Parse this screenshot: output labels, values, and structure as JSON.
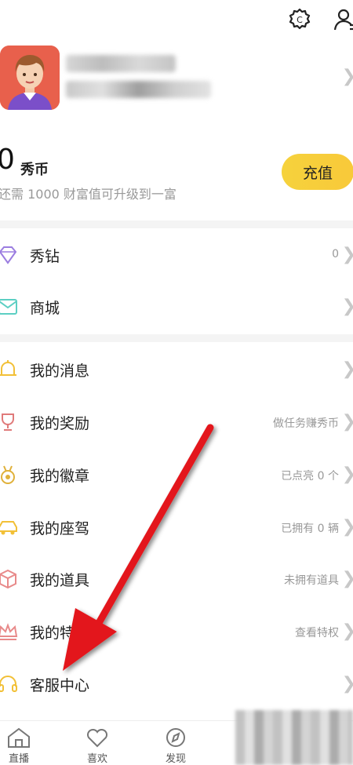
{
  "header": {
    "settings_icon": "gear-icon",
    "user_icon": "user-list-icon"
  },
  "wallet": {
    "coin_value": "0",
    "coin_unit": "秀币",
    "hint": "还需 1000 财富值可升级到一富",
    "recharge_label": "充值"
  },
  "menu_top": [
    {
      "label": "秀钻",
      "extra": "0",
      "icon": "diamond-icon"
    },
    {
      "label": "商城",
      "extra": "",
      "icon": "mall-icon"
    }
  ],
  "menu": [
    {
      "label": "我的消息",
      "extra": "",
      "icon": "bell-icon"
    },
    {
      "label": "我的奖励",
      "extra": "做任务赚秀币",
      "icon": "trophy-icon"
    },
    {
      "label": "我的徽章",
      "extra": "已点亮 0 个",
      "icon": "badge-icon"
    },
    {
      "label": "我的座驾",
      "extra": "已拥有 0 辆",
      "icon": "car-icon"
    },
    {
      "label": "我的道具",
      "extra": "未拥有道具",
      "icon": "box-icon"
    },
    {
      "label": "我的特",
      "extra": "查看特权",
      "icon": "crown-icon"
    },
    {
      "label": "客服中心",
      "extra": "",
      "icon": "headset-icon"
    }
  ],
  "tabs": [
    {
      "label": "直播",
      "icon": "home-icon"
    },
    {
      "label": "喜欢",
      "icon": "heart-icon"
    },
    {
      "label": "发现",
      "icon": "compass-icon"
    }
  ],
  "colors": {
    "accent": "#f6d23c",
    "annotation_arrow": "#e3191c"
  }
}
